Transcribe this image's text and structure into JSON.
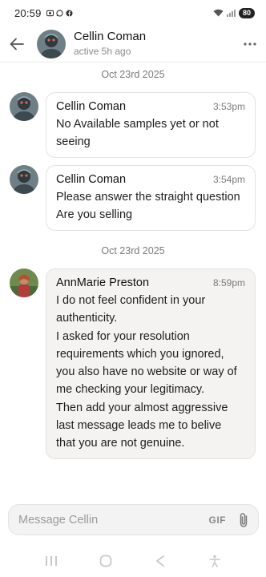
{
  "status_bar": {
    "time": "20:59",
    "battery": "80",
    "icons": [
      "screen-record-icon",
      "whatsapp-icon",
      "facebook-icon",
      "wifi-icon",
      "signal-icon"
    ]
  },
  "header": {
    "name": "Cellin Coman",
    "status": "active 5h ago"
  },
  "dates": [
    "Oct 23rd 2025",
    "Oct 23rd 2025"
  ],
  "messages": [
    {
      "sender": "Cellin Coman",
      "time": "3:53pm",
      "lines": [
        "No Available samples yet or not",
        "seeing"
      ]
    },
    {
      "sender": "Cellin Coman",
      "time": "3:54pm",
      "lines": [
        "Please answer the straight question",
        "Are you selling"
      ]
    },
    {
      "sender": "AnnMarie Preston",
      "time": "8:59pm",
      "lines": [
        "I do not feel confident in your",
        "authenticity.",
        "I asked for your resolution",
        "requirements which you ignored,",
        "you also have no website or way of",
        "me checking your legitimacy.",
        "Then add your almost aggressive",
        "last message leads me to belive",
        "that you are not genuine."
      ]
    }
  ],
  "composer": {
    "placeholder": "Message Cellin",
    "gif_label": "GIF"
  },
  "colors": {
    "accent": "#222222",
    "bubble_own_bg": "#f4f3f1",
    "bubble_border": "#e2e2e2"
  }
}
